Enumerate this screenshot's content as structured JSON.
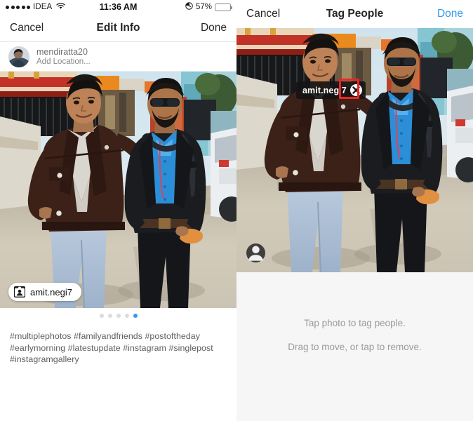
{
  "status_bar": {
    "signal_dots": 5,
    "carrier": "IDEA",
    "wifi_icon": "wifi-icon",
    "time": "11:36 AM",
    "alarm_icon": "alarm-clock-icon",
    "battery_percent": "57%",
    "battery_level": 57,
    "battery_color": "#fdc72f"
  },
  "left_panel": {
    "nav": {
      "cancel_label": "Cancel",
      "title": "Edit Info",
      "done_label": "Done"
    },
    "profile": {
      "avatar_icon": "user-avatar",
      "username": "mendiratta20",
      "location_placeholder": "Add Location..."
    },
    "photo": {
      "alt": "Two men standing on a street in front of a gated house with a white car parked at right",
      "tag_pill": {
        "icon": "id-badge-icon",
        "label": "amit.negi7"
      }
    },
    "annotation": {
      "arrow_color": "#f42222",
      "arrow_points_to": "amit.negi7 tag pill"
    },
    "pager": {
      "total_dots": 5,
      "active_index": 4,
      "active_color": "#3897f0",
      "inactive_color": "#dcdcdc"
    },
    "caption": "#multiplephotos  #familyandfriends #postoftheday #earlymorning #latestupdate #instagram #singlepost #instagramgallery"
  },
  "right_panel": {
    "nav": {
      "cancel_label": "Cancel",
      "title": "Tag People",
      "done_label": "Done",
      "done_color": "#3897f0"
    },
    "photo": {
      "alt": "Two men standing on a street in front of a gated house with a white car parked at right",
      "tag_bubble": {
        "label": "amit.negi7",
        "close_icon": "close-circle-icon"
      },
      "person_fab_icon": "person-icon"
    },
    "annotation": {
      "highlight_color": "#f42222",
      "highlights": "close-circle-icon on tag bubble"
    },
    "hints": [
      "Tap photo to tag people.",
      "Drag to move, or tap to remove."
    ]
  }
}
